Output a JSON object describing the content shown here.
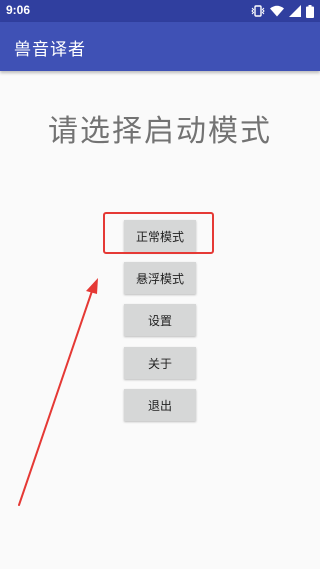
{
  "status_bar": {
    "time": "9:06",
    "icons": [
      "vibrate-icon",
      "wifi-icon",
      "signal-icon",
      "battery-icon"
    ]
  },
  "app_bar": {
    "title": "兽音译者"
  },
  "main": {
    "prompt": "请选择启动模式",
    "buttons": [
      {
        "label": "正常模式"
      },
      {
        "label": "悬浮模式"
      },
      {
        "label": "设置"
      },
      {
        "label": "关于"
      },
      {
        "label": "退出"
      }
    ]
  },
  "annotation": {
    "color": "#e53935"
  },
  "colors": {
    "status_bar": "#303f9f",
    "app_bar": "#3f51b5",
    "background": "#fafafa",
    "button": "#d6d7d7"
  }
}
